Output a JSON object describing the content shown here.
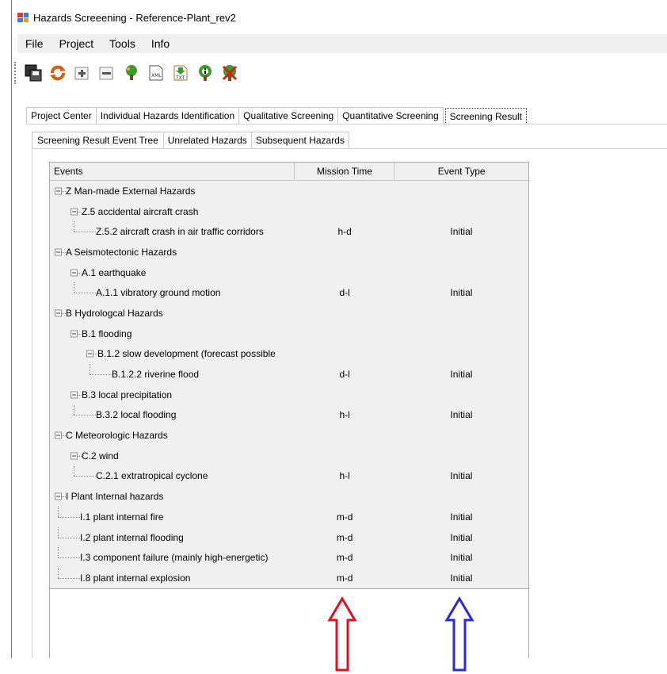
{
  "window": {
    "title": "Hazards Screeening - Reference-Plant_rev2"
  },
  "menu": [
    "File",
    "Project",
    "Tools",
    "Info"
  ],
  "toolbar": [
    "save-icon",
    "refresh-icon",
    "add-icon",
    "remove-icon",
    "tree-icon",
    "xml-icon",
    "txt-export-icon",
    "info-tree-icon",
    "delete-tree-icon"
  ],
  "toolbar_labels": {
    "xml": "XML",
    "txt": "TXT"
  },
  "tabs": [
    "Project Center",
    "Individual Hazards Identification",
    "Qualitative Screening",
    "Quantitative Screening",
    "Screening Result"
  ],
  "subtabs": [
    "Screening Result Event Tree",
    "Unrelated Hazards",
    "Subsequent Hazards"
  ],
  "grid": {
    "headers": [
      "Events",
      "Mission Time",
      "Event Type"
    ],
    "rows": [
      {
        "label": "Z  Man-made External Hazards",
        "time": "",
        "type": ""
      },
      {
        "label": "Z.5  accidental aircraft crash",
        "time": "",
        "type": ""
      },
      {
        "label": "Z.5.2  aircraft crash in air traffic corridors",
        "time": "h-d",
        "type": "Initial"
      },
      {
        "label": "A  Seismotectonic Hazards",
        "time": "",
        "type": ""
      },
      {
        "label": "A.1  earthquake",
        "time": "",
        "type": ""
      },
      {
        "label": "A.1.1  vibratory ground motion",
        "time": "d-l",
        "type": "Initial"
      },
      {
        "label": "B  Hydrologcal Hazards",
        "time": "",
        "type": ""
      },
      {
        "label": "B.1  flooding",
        "time": "",
        "type": ""
      },
      {
        "label": "B.1.2  slow development (forecast possible",
        "time": "",
        "type": ""
      },
      {
        "label": "B.1.2.2  riverine flood",
        "time": "d-l",
        "type": "Initial"
      },
      {
        "label": "B.3  local precipitation",
        "time": "",
        "type": ""
      },
      {
        "label": "B.3.2  local flooding",
        "time": "h-l",
        "type": "Initial"
      },
      {
        "label": "C  Meteorologic Hazards",
        "time": "",
        "type": ""
      },
      {
        "label": "C.2  wind",
        "time": "",
        "type": ""
      },
      {
        "label": "C.2.1  extratropical cyclone",
        "time": "h-l",
        "type": "Initial"
      },
      {
        "label": "I  Plant Internal hazards",
        "time": "",
        "type": ""
      },
      {
        "label": "I.1  plant internal fire",
        "time": "m-d",
        "type": "Initial"
      },
      {
        "label": "I.2  plant internal flooding",
        "time": "m-d",
        "type": "Initial"
      },
      {
        "label": "I.3  component failure (mainly high-energetic)",
        "time": "m-d",
        "type": "Initial"
      },
      {
        "label": "I.8  plant internal explosion",
        "time": "m-d",
        "type": "Initial"
      }
    ]
  },
  "annotations": {
    "arrow1_color": "#e0101c",
    "arrow2_color": "#2b2bd6"
  }
}
